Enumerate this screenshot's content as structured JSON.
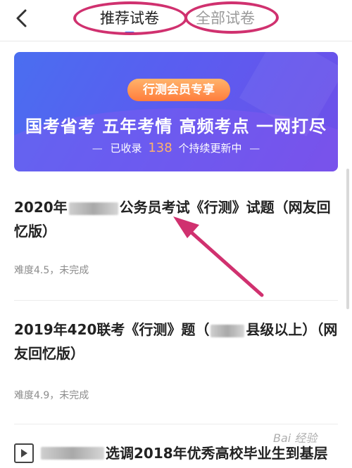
{
  "header": {
    "tabs": [
      {
        "label": "推荐试卷",
        "active": true
      },
      {
        "label": "全部试卷",
        "active": false
      }
    ],
    "accent": "#3b6ef5"
  },
  "banner": {
    "badge": "行测会员专享",
    "headline": "国考省考 五年考情 高频考点 一网打尽",
    "sub_prefix": "已收录",
    "sub_count": "138",
    "sub_suffix": "个持续更新中"
  },
  "papers": [
    {
      "title_start": "2020年",
      "title_end": "公务员考试《行测》试题（网友回忆版）",
      "difficulty": "难度4.5，未完成"
    },
    {
      "title_start": "2019年420联考《行测》题（",
      "title_end": "县级以上）（网友回忆版）",
      "difficulty": "难度4.9，未完成"
    },
    {
      "title_end": "选调2018年优秀高校毕业生到基层"
    }
  ],
  "watermark": "Bai 经验",
  "colors": {
    "highlight": "#d0316f",
    "banner_start": "#4a6ef0",
    "banner_end": "#6f4fe8",
    "badge": "#ff8a45"
  }
}
